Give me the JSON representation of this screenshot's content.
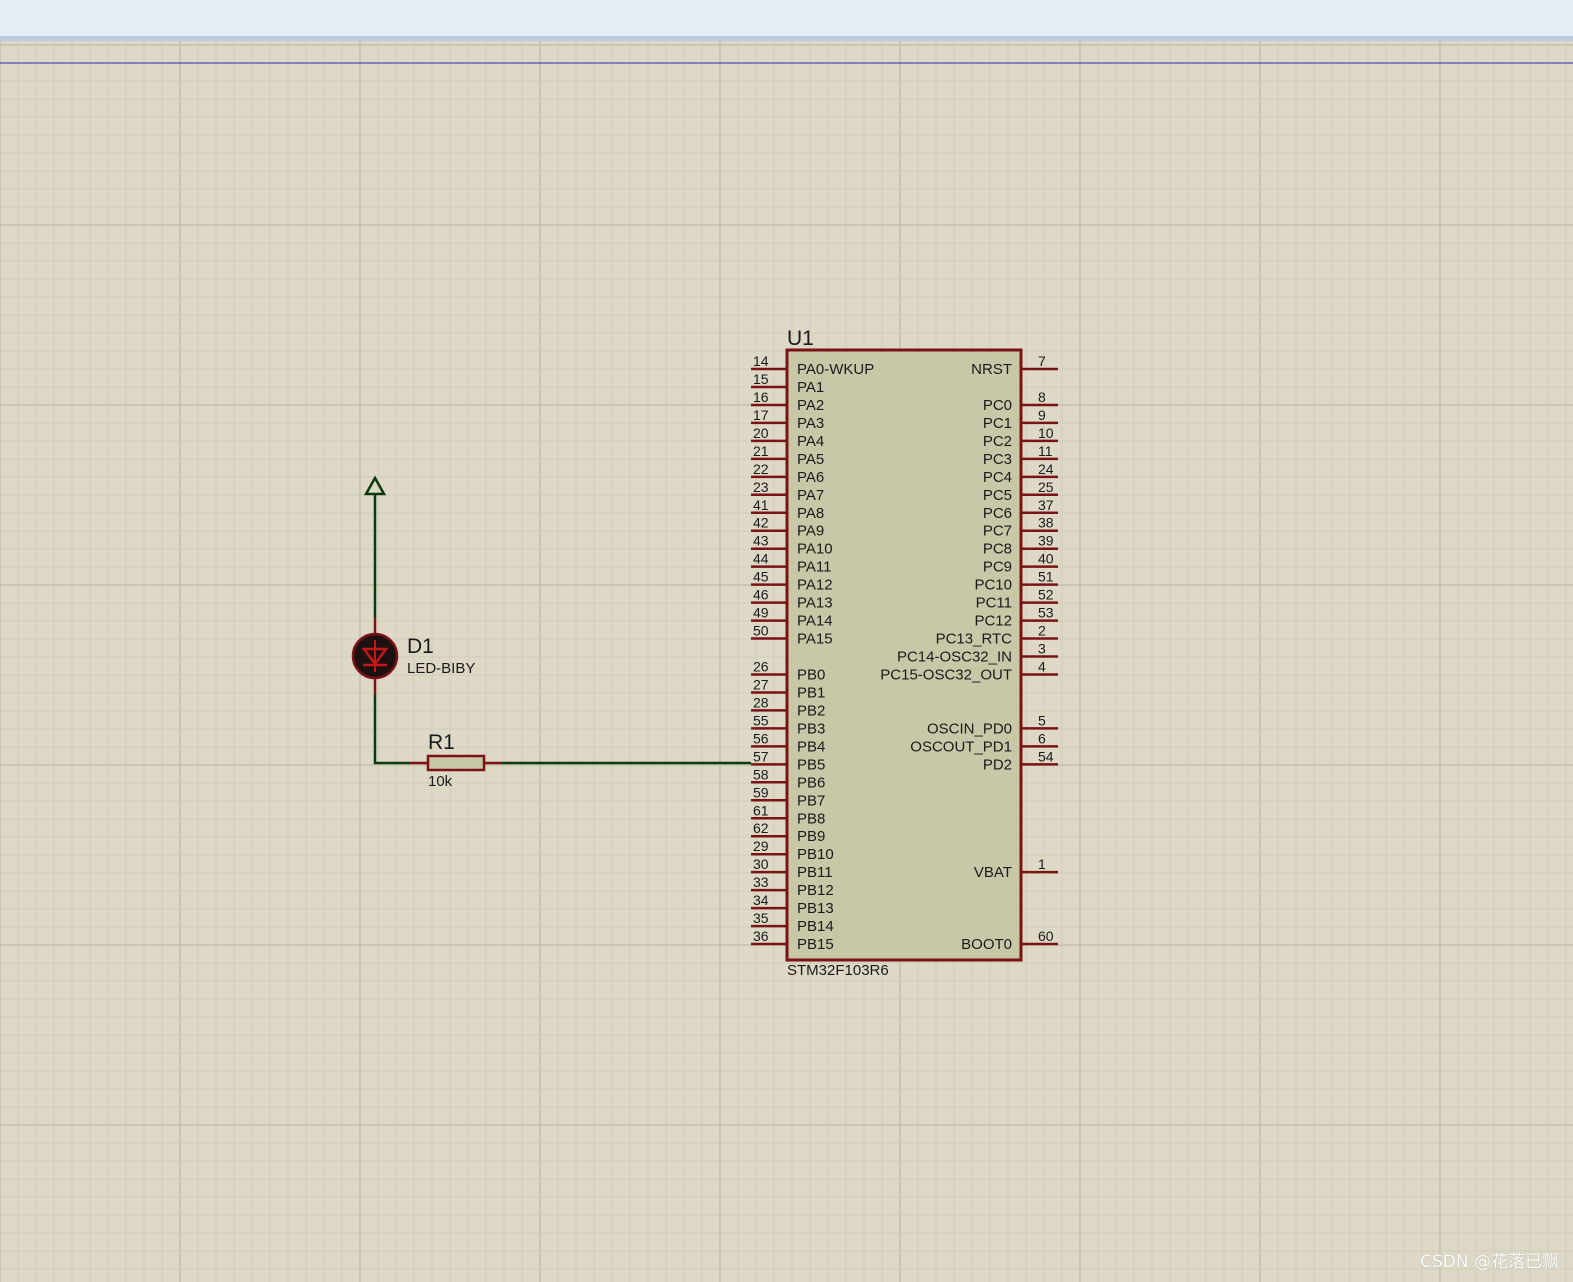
{
  "colors": {
    "sheet": "#ddd9c6",
    "grid_minor": "#cdc9b4",
    "grid_major": "#bfbba6",
    "component_outline": "#7a1414",
    "component_fill": "#c8c7a8",
    "wire": "#0c3a0c",
    "title_line": "#2a2ab0"
  },
  "components": {
    "u1": {
      "ref": "U1",
      "part": "STM32F103R6",
      "left_pins": [
        {
          "num": "14",
          "name": "PA0-WKUP"
        },
        {
          "num": "15",
          "name": "PA1"
        },
        {
          "num": "16",
          "name": "PA2"
        },
        {
          "num": "17",
          "name": "PA3"
        },
        {
          "num": "20",
          "name": "PA4"
        },
        {
          "num": "21",
          "name": "PA5"
        },
        {
          "num": "22",
          "name": "PA6"
        },
        {
          "num": "23",
          "name": "PA7"
        },
        {
          "num": "41",
          "name": "PA8"
        },
        {
          "num": "42",
          "name": "PA9"
        },
        {
          "num": "43",
          "name": "PA10"
        },
        {
          "num": "44",
          "name": "PA11"
        },
        {
          "num": "45",
          "name": "PA12"
        },
        {
          "num": "46",
          "name": "PA13"
        },
        {
          "num": "49",
          "name": "PA14"
        },
        {
          "num": "50",
          "name": "PA15"
        },
        null,
        {
          "num": "26",
          "name": "PB0"
        },
        {
          "num": "27",
          "name": "PB1"
        },
        {
          "num": "28",
          "name": "PB2"
        },
        {
          "num": "55",
          "name": "PB3"
        },
        {
          "num": "56",
          "name": "PB4"
        },
        {
          "num": "57",
          "name": "PB5"
        },
        {
          "num": "58",
          "name": "PB6"
        },
        {
          "num": "59",
          "name": "PB7"
        },
        {
          "num": "61",
          "name": "PB8"
        },
        {
          "num": "62",
          "name": "PB9"
        },
        {
          "num": "29",
          "name": "PB10"
        },
        {
          "num": "30",
          "name": "PB11"
        },
        {
          "num": "33",
          "name": "PB12"
        },
        {
          "num": "34",
          "name": "PB13"
        },
        {
          "num": "35",
          "name": "PB14"
        },
        {
          "num": "36",
          "name": "PB15"
        }
      ],
      "right_pins": [
        {
          "num": "7",
          "name": "NRST"
        },
        null,
        {
          "num": "8",
          "name": "PC0"
        },
        {
          "num": "9",
          "name": "PC1"
        },
        {
          "num": "10",
          "name": "PC2"
        },
        {
          "num": "11",
          "name": "PC3"
        },
        {
          "num": "24",
          "name": "PC4"
        },
        {
          "num": "25",
          "name": "PC5"
        },
        {
          "num": "37",
          "name": "PC6"
        },
        {
          "num": "38",
          "name": "PC7"
        },
        {
          "num": "39",
          "name": "PC8"
        },
        {
          "num": "40",
          "name": "PC9"
        },
        {
          "num": "51",
          "name": "PC10"
        },
        {
          "num": "52",
          "name": "PC11"
        },
        {
          "num": "53",
          "name": "PC12"
        },
        {
          "num": "2",
          "name": "PC13_RTC"
        },
        {
          "num": "3",
          "name": "PC14-OSC32_IN"
        },
        {
          "num": "4",
          "name": "PC15-OSC32_OUT"
        },
        null,
        null,
        {
          "num": "5",
          "name": "OSCIN_PD0"
        },
        {
          "num": "6",
          "name": "OSCOUT_PD1"
        },
        {
          "num": "54",
          "name": "PD2"
        },
        null,
        null,
        null,
        null,
        null,
        {
          "num": "1",
          "name": "VBAT"
        },
        null,
        null,
        null,
        {
          "num": "60",
          "name": "BOOT0"
        }
      ]
    },
    "d1": {
      "ref": "D1",
      "part": "LED-BIBY"
    },
    "r1": {
      "ref": "R1",
      "value": "10k"
    },
    "power_terminal": {
      "icon": "power-arrow-icon"
    }
  },
  "watermark": "CSDN @花落已飘"
}
